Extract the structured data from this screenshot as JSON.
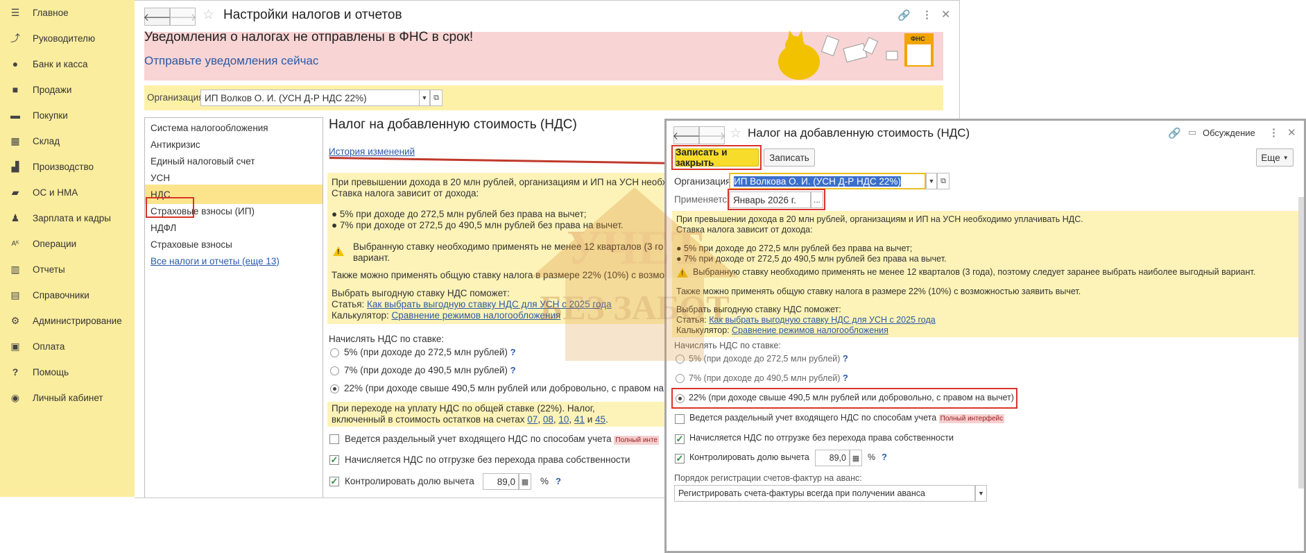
{
  "sidebar": {
    "items": [
      {
        "label": "Главное",
        "icon": "menu-icon"
      },
      {
        "label": "Руководителю",
        "icon": "trend-icon"
      },
      {
        "label": "Банк и касса",
        "icon": "coin-icon"
      },
      {
        "label": "Продажи",
        "icon": "bag-icon"
      },
      {
        "label": "Покупки",
        "icon": "basket-icon"
      },
      {
        "label": "Склад",
        "icon": "grid-icon"
      },
      {
        "label": "Производство",
        "icon": "factory-icon"
      },
      {
        "label": "ОС и НМА",
        "icon": "truck-icon"
      },
      {
        "label": "Зарплата и кадры",
        "icon": "person-icon"
      },
      {
        "label": "Операции",
        "icon": "operations-icon"
      },
      {
        "label": "Отчеты",
        "icon": "bar-chart-icon"
      },
      {
        "label": "Справочники",
        "icon": "books-icon"
      },
      {
        "label": "Администрирование",
        "icon": "gear-icon"
      },
      {
        "label": "Оплата",
        "icon": "payment-icon"
      },
      {
        "label": "Помощь",
        "icon": "question-icon"
      },
      {
        "label": "Личный кабинет",
        "icon": "account-icon"
      }
    ]
  },
  "win1": {
    "title": "Настройки налогов и отчетов",
    "banner_title": "Уведомления о налогах не отправлены в ФНС в срок!",
    "banner_link": "Отправьте уведомления сейчас",
    "fns_label": "ФНС",
    "org_label": "Организация:",
    "org_value": "ИП Волков О. И. (УСН Д-Р НДС 22%)",
    "tax_items": [
      "Система налогообложения",
      "Антикризис",
      "Единый налоговый счет",
      "УСН",
      "НДС",
      "Страховые взносы (ИП)",
      "НДФЛ",
      "Страховые взносы"
    ],
    "all_taxes_link": "Все налоги и отчеты (еще 13)",
    "section_title": "Налог на добавленную стоимость (НДС)",
    "history_link": "История изменений",
    "info_line1": "При превышении дохода в 20 млн рублей, организациям и ИП на УСН необх",
    "info_line2": "Ставка налога зависит от дохода:",
    "info_bullet1": "● 5% при доходе до 272,5 млн рублей без права на вычет;",
    "info_bullet2": "● 7% при доходе от 272,5 до 490,5 млн рублей без права на вычет.",
    "warn_text1": "Выбранную ставку необходимо применять не менее 12 кварталов (3 го",
    "warn_text2": "вариант.",
    "general_rate_text": "Также можно применять общую ставку налога в размере 22% (10%) с возмо",
    "choose_text": "Выбрать выгодную ставку НДС поможет:",
    "article_label": "Статья:",
    "article_link": "Как выбрать выгодную ставку НДС для УСН с 2025 года",
    "calc_label": "Калькулятор:",
    "calc_link": "Сравнение режимов налогообложения",
    "rate_label": "Начислять НДС по ставке:",
    "rate_5": "5% (при доходе до 272,5 млн рублей)",
    "rate_7": "7% (при доходе до 490,5 млн рублей)",
    "rate_22": "22% (при доходе свыше 490,5 млн рублей или добровольно, с правом на",
    "transition_text1": "При переходе на уплату НДС по общей ставке (22%). Налог,",
    "transition_text2": "включенный в стоимость остатков на счетах",
    "accounts": [
      "07",
      "08",
      "10",
      "41",
      "45"
    ],
    "separate_accounting": "Ведется раздельный учет входящего НДС по способам учета",
    "full_interface_badge": "Полный инте",
    "vat_shipment": "Начисляется НДС по отгрузке без перехода права собственности",
    "control_share": "Контролировать долю вычета",
    "control_value": "89,0",
    "percent": "%",
    "qmark": "?"
  },
  "win2": {
    "title": "Налог на добавленную стоимость (НДС)",
    "discussion": "Обсуждение",
    "save_close": "Записать и закрыть",
    "save": "Записать",
    "more": "Еще",
    "org_label": "Организация:",
    "org_value": "ИП Волкова О. И. (УСН Д-Р НДС 22%)",
    "applies_label": "Применяется с:",
    "applies_value": "Январь 2026 г.",
    "ellipsis": "...",
    "info_line1": "При превышении дохода в 20 млн рублей, организациям и ИП на УСН необходимо уплачивать НДС.",
    "info_line2": "Ставка налога зависит от дохода:",
    "info_bullet1": "● 5% при доходе до 272,5 млн рублей без права на вычет;",
    "info_bullet2": "● 7% при доходе от 272,5 до 490,5 млн рублей без права на вычет.",
    "warn_text": "Выбранную ставку необходимо применять не менее 12 кварталов (3 года), поэтому следует заранее выбрать наиболее выгодный вариант.",
    "general_rate_text": "Также можно применять общую ставку налога в размере 22% (10%) с возможностью заявить вычет.",
    "choose_text": "Выбрать выгодную ставку НДС поможет:",
    "article_label": "Статья:",
    "article_link": "Как выбрать выгодную ставку НДС для УСН с 2025 года",
    "calc_label": "Калькулятор:",
    "calc_link": "Сравнение режимов налогообложения",
    "rate_label": "Начислять НДС по ставке:",
    "rate_5": "5% (при доходе до 272,5 млн рублей)",
    "rate_7": "7% (при доходе до 490,5 млн рублей)",
    "rate_22": "22% (при доходе свыше 490,5 млн рублей или добровольно, с правом на вычет)",
    "separate_accounting": "Ведется раздельный учет входящего НДС по способам учета",
    "full_interface_badge": "Полный интерфейс",
    "vat_shipment": "Начисляется НДС по отгрузке без перехода права собственности",
    "control_share": "Контролировать долю вычета",
    "control_value": "89,0",
    "percent": "%",
    "qmark": "?",
    "invoice_order_label": "Порядок регистрации счетов-фактур на аванс:",
    "invoice_order_value": "Регистрировать счета-фактуры всегда при получении аванса"
  },
  "watermark": {
    "line1": "УЧЕТ",
    "line2": "БЕЗ ЗАБОТ"
  },
  "colors": {
    "sidebar": "#fbed9e",
    "banner": "#f8d4d4",
    "info": "#fdf3b8",
    "highlight_red": "#d9342b",
    "primary_button": "#f7dc2b",
    "link": "#2a5aa8"
  }
}
